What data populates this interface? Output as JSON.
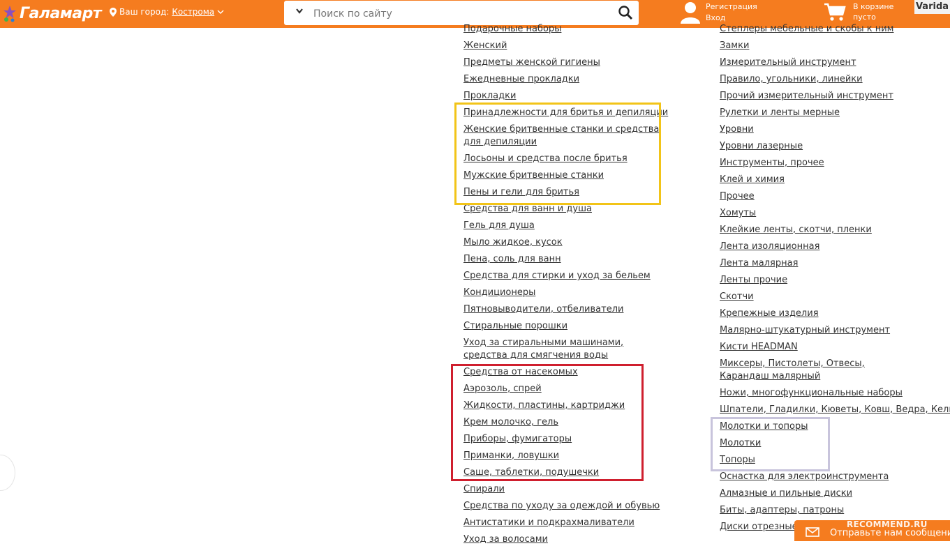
{
  "header": {
    "logo_text": "Галамарт",
    "city_label": "Ваш город:",
    "city_name": "Кострома",
    "search_placeholder": "Поиск по сайту",
    "register_label": "Регистрация",
    "login_label": "Вход",
    "cart_line1": "В корзине",
    "cart_line2": "пусто",
    "user_name": "Varida",
    "colors": {
      "bar": "#f57c1f",
      "text": "#ffffff"
    }
  },
  "column_left": [
    "Подарочные наборы",
    "Женский",
    "Предметы женской гигиены",
    "Ежедневные прокладки",
    "Прокладки",
    "Принадлежности для бритья и депиляции",
    "Женские бритвенные станки и средства для депиляции",
    "Лосьоны и средства после бритья",
    "Мужские бритвенные станки",
    "Пены и гели для бритья",
    "Средства для ванн и душа",
    "Гель для душа",
    "Мыло жидкое, кусок",
    "Пена, соль для ванн",
    "Средства для стирки и уход за бельем",
    "Кондиционеры",
    "Пятновыводители, отбеливатели",
    "Стиральные порошки",
    "Уход за стиральными машинами, средства для смягчения воды",
    "Средства от насекомых",
    "Аэрозоль, спрей",
    "Жидкости, пластины, картриджи",
    "Крем молочко, гель",
    "Приборы, фумигаторы",
    "Приманки, ловушки",
    "Саше, таблетки, подушечки",
    "Спирали",
    "Средства по уходу за одеждой и обувью",
    "Антистатики и подкрахмаливатели",
    "Уход за волосами"
  ],
  "column_right": [
    "Степлеры мебельные и скобы к ним",
    "Замки",
    "Измерительный инструмент",
    "Правило, угольники, линейки",
    "Прочий измерительный инструмент",
    "Рулетки и ленты мерные",
    "Уровни",
    "Уровни лазерные",
    "Инструменты, прочее",
    "Клей и химия",
    "Прочее",
    "Хомуты",
    "Клейкие ленты, скотчи, пленки",
    "Лента изоляционная",
    "Лента малярная",
    "Ленты прочие",
    "Скотчи",
    "Крепежные изделия",
    "Малярно-штукатурный инструмент",
    "Кисти HEADMAN",
    "Миксеры, Пистолеты, Отвесы, Карандаш малярный",
    "Ножи, многофункциональные наборы",
    "Шпатели, Гладилки, Кюветы, Ковш, Ведра, Кельмы",
    "Молотки и топоры",
    "Молотки",
    "Топоры",
    "Оснастка для электроинструмента",
    "Алмазные и пильные диски",
    "Биты, адаптеры, патроны",
    "Диски отрезные"
  ],
  "feedback_label": "Отправьте нам сообщение",
  "watermark": "RECOMMEND.RU",
  "highlight_colors": {
    "yellow": "#f2c418",
    "red": "#cf1f2e",
    "purple": "#c8c4dc"
  }
}
